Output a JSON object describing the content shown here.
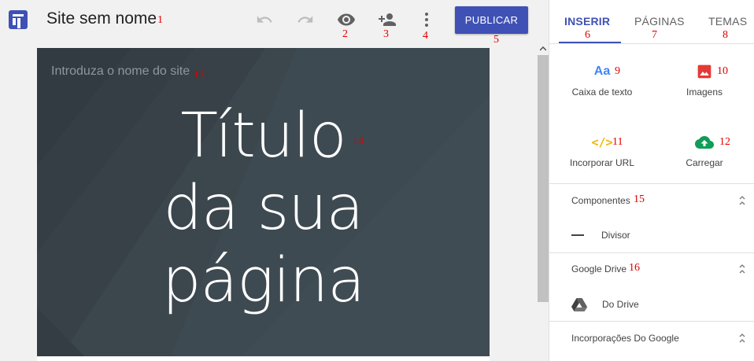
{
  "app": {
    "site_title": "Site sem nome",
    "publish_label": "PUBLICAR"
  },
  "toolbar": {
    "icons": [
      "undo-icon",
      "redo-icon",
      "preview-eye-icon",
      "share-add-person-icon",
      "more-vert-icon"
    ]
  },
  "canvas": {
    "site_name_placeholder": "Introduza o nome do site",
    "page_title_lines": [
      "Título",
      "da sua",
      "página"
    ]
  },
  "panel": {
    "tabs": [
      {
        "label": "INSERIR",
        "active": true
      },
      {
        "label": "PÁGINAS",
        "active": false
      },
      {
        "label": "TEMAS",
        "active": false
      }
    ],
    "insert_tiles": [
      {
        "label": "Caixa de texto",
        "icon": "text-box-icon",
        "glyph": "Aa"
      },
      {
        "label": "Imagens",
        "icon": "image-icon"
      },
      {
        "label": "Incorporar URL",
        "icon": "embed-code-icon",
        "glyph": "</>"
      },
      {
        "label": "Carregar",
        "icon": "upload-cloud-icon"
      }
    ],
    "sections": [
      {
        "title": "Componentes",
        "items": [
          {
            "label": "Divisor",
            "icon": "divider-icon"
          }
        ]
      },
      {
        "title": "Google Drive",
        "items": [
          {
            "label": "Do Drive",
            "icon": "drive-icon"
          }
        ]
      },
      {
        "title": "Incorporações Do Google",
        "items": []
      }
    ]
  },
  "markers": [
    "1",
    "2",
    "3",
    "4",
    "5",
    "6",
    "7",
    "8",
    "9",
    "10",
    "11",
    "12",
    "13",
    "14",
    "15",
    "16"
  ],
  "colors": {
    "accent": "#3f51b5",
    "canvas_bg": "#38434a",
    "marker_red": "#e00000",
    "image_icon_red": "#e53935",
    "embed_icon_yellow": "#f4b400",
    "upload_icon_green": "#0f9d58",
    "text_icon_blue": "#4285f4"
  }
}
